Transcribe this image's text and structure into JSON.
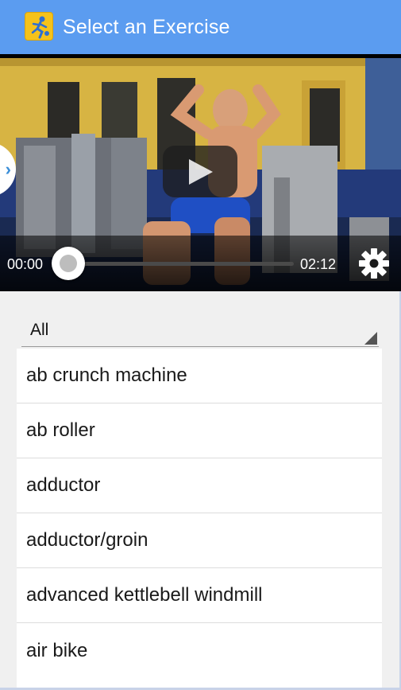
{
  "app_bar": {
    "title": "Select an Exercise",
    "icon": "running-figure-app-icon",
    "color": "#5b9cf0"
  },
  "video_player": {
    "current_time": "00:00",
    "total_time": "02:12",
    "progress": 0,
    "play_icon": "play-icon",
    "settings_icon": "gear-icon",
    "side_handle_icon": "chevron-right-icon"
  },
  "filter": {
    "selected": "All"
  },
  "exercises": [
    {
      "label": "ab crunch machine"
    },
    {
      "label": "ab roller"
    },
    {
      "label": "adductor"
    },
    {
      "label": "adductor/groin"
    },
    {
      "label": "advanced kettlebell windmill"
    },
    {
      "label": "air bike"
    }
  ]
}
